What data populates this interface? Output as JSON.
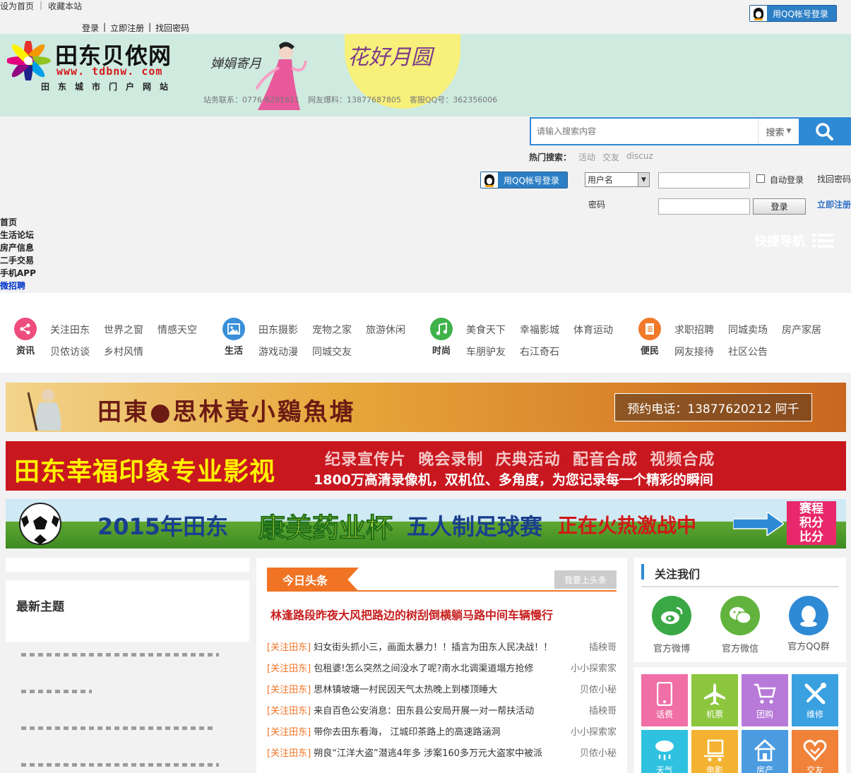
{
  "topbar": {
    "set_home": "设为首页",
    "bookmark": "收藏本站",
    "qq_login": "用QQ帐号登录"
  },
  "login_links": {
    "login": "登录",
    "register": "立即注册",
    "find_password": "找回密码"
  },
  "banner": {
    "site_name": "田东贝侬网",
    "url": "www. tdbnw. com",
    "subtitle": "田东城市门户网站",
    "contact": [
      "站务联系：0776-6291611",
      "网友爆料：13877687805",
      "客服QQ号：362356006"
    ],
    "calligraphy": "婵娟寄月",
    "moon_text": "花好月圆"
  },
  "search": {
    "placeholder": "请输入搜索内容",
    "type": "搜索",
    "hot_label": "热门搜索：",
    "hot": [
      "活动",
      "交友",
      "discuz"
    ]
  },
  "login_form": {
    "qq_login": "用QQ帐号登录",
    "username_option": "用户名",
    "password_label": "密码",
    "auto_login": "自动登录",
    "find_password": "找回密码",
    "login_button": "登录",
    "register": "立即注册"
  },
  "nav": [
    "首页",
    "生活论坛",
    "房产信息",
    "二手交易",
    "手机APP",
    "微招聘"
  ],
  "quick_nav": "快捷导航",
  "categories": [
    {
      "label": "资讯",
      "color": "#ee4d7e",
      "links": [
        "关注田东",
        "世界之窗",
        "情感天空",
        "贝侬访谈",
        "乡村风情"
      ]
    },
    {
      "label": "生活",
      "color": "#3a8fd8",
      "links": [
        "田东摄影",
        "宠物之家",
        "旅游休闲",
        "游戏动漫",
        "同城交友"
      ]
    },
    {
      "label": "时尚",
      "color": "#3fb24a",
      "links": [
        "美食天下",
        "幸福影城",
        "体育运动",
        "车朋驴友",
        "右江奇石"
      ]
    },
    {
      "label": "便民",
      "color": "#f07a2a",
      "links": [
        "求职招聘",
        "同城卖场",
        "房产家居",
        "网友接待",
        "社区公告"
      ]
    }
  ],
  "ads": {
    "ad1_title": "田東●思林黃小鷄魚塘",
    "ad1_phone": "预约电话：13877620212 阿千",
    "ad2_title": "田东幸福印象专业影视",
    "ad2_line1": "纪录宣传片  晚会录制  庆典活动  配音合成  视频合成",
    "ad2_line2": "1800万高清录像机，双机位、多角度，为您记录每一个精彩的瞬间",
    "ad3_year": "2015年田东",
    "ad3_cup": "康美药业杯",
    "ad3_event": "五人制足球赛",
    "ad3_status": "正在火热激战中",
    "ad3_side": [
      "赛程",
      "积分",
      "比分"
    ]
  },
  "latest": {
    "title": "最新主题"
  },
  "headlines": {
    "tag": "今日头条",
    "post_button": "我要上头条",
    "top_title": "林逢路段昨夜大风把路边的树刮倒横躺马路中间车辆慢行",
    "items": [
      {
        "cat": "[关注田东]",
        "title": "妇女街头抓小三，画面太暴力！！插言为田东人民决战！！",
        "author": "插秧哥"
      },
      {
        "cat": "[关注田东]",
        "title": "包租婆!怎么突然之间没水了呢?南水北调渠道塌方抢修",
        "author": "小小探索家"
      },
      {
        "cat": "[关注田东]",
        "title": "思林镇坡塘一村民因天气太热晚上到楼顶睡大",
        "author": "贝侬小秘"
      },
      {
        "cat": "[关注田东]",
        "title": "来自百色公安消息：田东县公安局开展一对一帮扶活动",
        "author": "插秧哥"
      },
      {
        "cat": "[关注田东]",
        "title": "带你去田东看海， 江城印茶路上的高速路涵洞",
        "author": "小小探索家"
      },
      {
        "cat": "[关注田东]",
        "title": "朔良“江洋大盗”潜逃4年多 涉案160多万元大盗家中被派",
        "author": "贝侬小秘"
      }
    ]
  },
  "follow": {
    "title": "关注我们",
    "items": [
      {
        "label": "官方微博",
        "color": "#3aa845"
      },
      {
        "label": "官方微信",
        "color": "#62b33e"
      },
      {
        "label": "官方QQ群",
        "color": "#2f8ad6"
      }
    ]
  },
  "services": [
    {
      "label": "话费",
      "color": "#f06fa6"
    },
    {
      "label": "机票",
      "color": "#8cc63e"
    },
    {
      "label": "团购",
      "color": "#b77ad8"
    },
    {
      "label": "维修",
      "color": "#3aa0e0"
    },
    {
      "label": "天气",
      "color": "#2fc1e0"
    },
    {
      "label": "电影",
      "color": "#f3b331"
    },
    {
      "label": "房产",
      "color": "#4b9be0"
    },
    {
      "label": "交友",
      "color": "#f0823a"
    }
  ]
}
